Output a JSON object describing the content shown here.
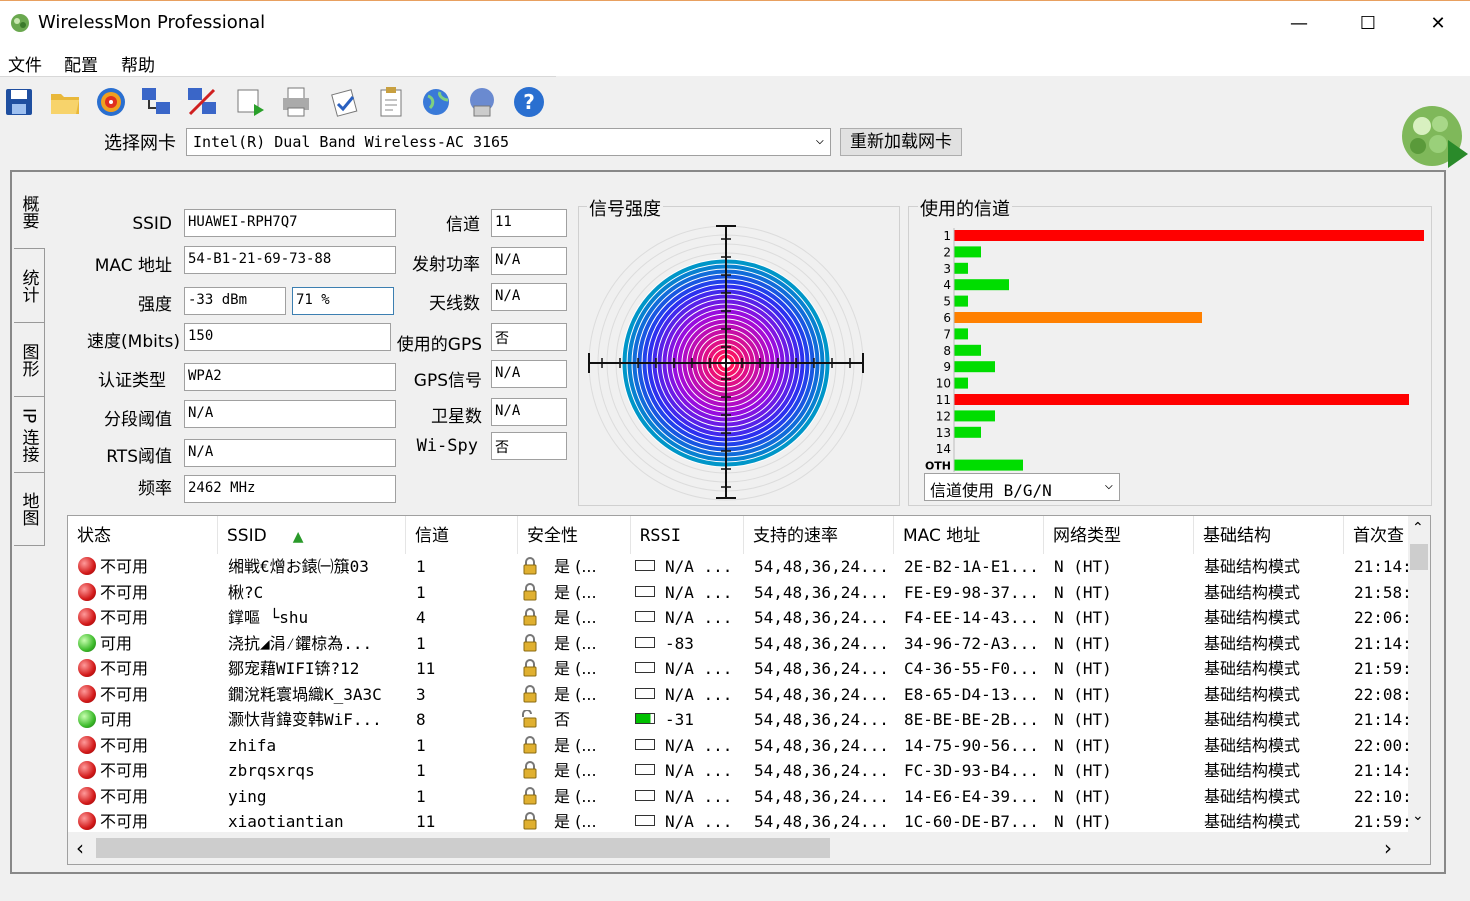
{
  "window": {
    "title": "WirelessMon Professional",
    "minimize": "—",
    "maximize": "☐",
    "close": "✕"
  },
  "menu": {
    "file": "文件",
    "config": "配置",
    "help": "帮助"
  },
  "toolbar": {
    "icons": [
      "save-icon",
      "open-folder-icon",
      "target-icon",
      "network-icon",
      "network-config-icon",
      "print-preview-icon",
      "printer-icon",
      "checklist-icon",
      "clipboard-icon",
      "globe-icon",
      "web-icon",
      "help-icon"
    ]
  },
  "nic": {
    "label": "选择网卡",
    "selected": "Intel(R) Dual Band Wireless-AC 3165",
    "reload": "重新加载网卡"
  },
  "tabs": [
    "概要",
    "统计",
    "图形",
    "IP 连接",
    "地图"
  ],
  "summary": {
    "ssid_label": "SSID",
    "ssid": "HUAWEI-RPH7Q7",
    "mac_label": "MAC 地址",
    "mac": "54-B1-21-69-73-88",
    "strength_label": "强度",
    "strength_dbm": "-33 dBm",
    "strength_pct": "71 %",
    "speed_label": "速度(Mbits)",
    "speed": "150",
    "auth_label": "认证类型",
    "auth": "WPA2",
    "frag_label": "分段阈值",
    "frag": "N/A",
    "rts_label": "RTS阈值",
    "rts": "N/A",
    "freq_label": "频率",
    "freq": "2462 MHz",
    "channel_label": "信道",
    "channel": "11",
    "txpower_label": "发射功率",
    "txpower": "N/A",
    "antenna_label": "天线数",
    "antenna": "N/A",
    "gps_used_label": "使用的GPS",
    "gps_used": "否",
    "gps_signal_label": "GPS信号",
    "gps_signal": "N/A",
    "satellites_label": "卫星数",
    "satellites": "N/A",
    "wispy_label": "Wi-Spy",
    "wispy": "否"
  },
  "signal": {
    "title": "信号强度"
  },
  "channels": {
    "title": "使用的信道",
    "select": "信道使用 B/G/N",
    "labels": [
      "1",
      "2",
      "3",
      "4",
      "5",
      "6",
      "7",
      "8",
      "9",
      "10",
      "11",
      "12",
      "13",
      "14",
      "OTH"
    ],
    "values": [
      470,
      27,
      14,
      55,
      14,
      248,
      14,
      27,
      41,
      14,
      455,
      41,
      27,
      0,
      69
    ],
    "colors": [
      "#ff0000",
      "#00dd00",
      "#00dd00",
      "#00dd00",
      "#00dd00",
      "#ff8000",
      "#00dd00",
      "#00dd00",
      "#00dd00",
      "#00dd00",
      "#ff0000",
      "#00dd00",
      "#00dd00",
      "#00dd00",
      "#00dd00"
    ]
  },
  "table": {
    "headers": [
      "状态",
      "SSID",
      "信道",
      "安全性",
      "RSSI",
      "支持的速率",
      "MAC 地址",
      "网络类型",
      "基础结构",
      "首次查"
    ],
    "sort_indicator": "▲",
    "rows": [
      {
        "status": "不可用",
        "ok": false,
        "ssid": "缃戦€熷お鎱㈠簱03",
        "ch": "1",
        "sec": "是 (...",
        "locked": true,
        "rssi": "N/A ...",
        "bar": false,
        "rates": "54,48,36,24...",
        "mac": "2E-B2-1A-E1...",
        "type": "N (HT)",
        "infra": "基础结构模式",
        "first": "21:14:"
      },
      {
        "status": "不可用",
        "ok": false,
        "ssid": "楸?C",
        "ch": "1",
        "sec": "是 (...",
        "locked": true,
        "rssi": "N/A ...",
        "bar": false,
        "rates": "54,48,36,24...",
        "mac": "FE-E9-98-37...",
        "type": "N (HT)",
        "infra": "基础结构模式",
        "first": "21:58:"
      },
      {
        "status": "不可用",
        "ok": false,
        "ssid": "鐣嘔 └shu",
        "ch": "4",
        "sec": "是 (...",
        "locked": true,
        "rssi": "N/A ...",
        "bar": false,
        "rates": "54,48,36,24...",
        "mac": "F4-EE-14-43...",
        "type": "N (HT)",
        "infra": "基础结构模式",
        "first": "22:06:"
      },
      {
        "status": "可用",
        "ok": true,
        "ssid": "浇抗◢涓⁄鑺椋為...",
        "ch": "1",
        "sec": "是 (...",
        "locked": true,
        "rssi": "-83",
        "bar": false,
        "rates": "54,48,36,24...",
        "mac": "34-96-72-A3...",
        "type": "N (HT)",
        "infra": "基础结构模式",
        "first": "21:14:"
      },
      {
        "status": "不可用",
        "ok": false,
        "ssid": "鄒宠藉WIFI锛?12",
        "ch": "11",
        "sec": "是 (...",
        "locked": true,
        "rssi": "N/A ...",
        "bar": false,
        "rates": "54,48,36,24...",
        "mac": "C4-36-55-F0...",
        "type": "N (HT)",
        "infra": "基础结构模式",
        "first": "21:59:"
      },
      {
        "status": "不可用",
        "ok": false,
        "ssid": "鐗涗粍寰堝織K_3A3C",
        "ch": "3",
        "sec": "是 (...",
        "locked": true,
        "rssi": "N/A ...",
        "bar": false,
        "rates": "54,48,36,24...",
        "mac": "E8-65-D4-13...",
        "type": "N (HT)",
        "infra": "基础结构模式",
        "first": "22:08:"
      },
      {
        "status": "可用",
        "ok": true,
        "ssid": "灏忕背鍏变韩WiF...",
        "ch": "8",
        "sec": "否",
        "locked": false,
        "rssi": "-31",
        "bar": true,
        "rates": "54,48,36,24...",
        "mac": "8E-BE-BE-2B...",
        "type": "N (HT)",
        "infra": "基础结构模式",
        "first": "21:14:"
      },
      {
        "status": "不可用",
        "ok": false,
        "ssid": "zhifa",
        "ch": "1",
        "sec": "是 (...",
        "locked": true,
        "rssi": "N/A ...",
        "bar": false,
        "rates": "54,48,36,24...",
        "mac": "14-75-90-56...",
        "type": "N (HT)",
        "infra": "基础结构模式",
        "first": "22:00:"
      },
      {
        "status": "不可用",
        "ok": false,
        "ssid": "zbrqsxrqs",
        "ch": "1",
        "sec": "是 (...",
        "locked": true,
        "rssi": "N/A ...",
        "bar": false,
        "rates": "54,48,36,24...",
        "mac": "FC-3D-93-B4...",
        "type": "N (HT)",
        "infra": "基础结构模式",
        "first": "21:14:"
      },
      {
        "status": "不可用",
        "ok": false,
        "ssid": "ying",
        "ch": "1",
        "sec": "是 (...",
        "locked": true,
        "rssi": "N/A ...",
        "bar": false,
        "rates": "54,48,36,24...",
        "mac": "14-E6-E4-39...",
        "type": "N (HT)",
        "infra": "基础结构模式",
        "first": "22:10:"
      },
      {
        "status": "不可用",
        "ok": false,
        "ssid": "xiaotiantian",
        "ch": "11",
        "sec": "是 (...",
        "locked": true,
        "rssi": "N/A ...",
        "bar": false,
        "rates": "54,48,36,24...",
        "mac": "1C-60-DE-B7...",
        "type": "N (HT)",
        "infra": "基础结构模式",
        "first": "21:59:"
      }
    ]
  },
  "scroll": {
    "up": "⌃",
    "down": "⌄",
    "left": "‹",
    "right": "›"
  }
}
